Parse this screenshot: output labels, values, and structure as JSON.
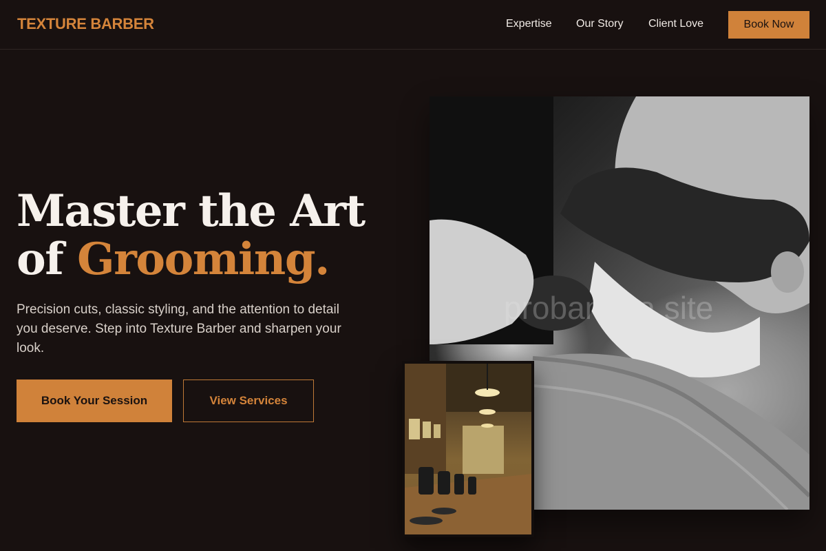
{
  "brand": {
    "name": "TEXTURE BARBER",
    "accent_color": "#d4843a",
    "background_color": "#181110"
  },
  "nav": {
    "links": [
      {
        "label": "Expertise"
      },
      {
        "label": "Our Story"
      },
      {
        "label": "Client Love"
      }
    ],
    "cta_label": "Book Now"
  },
  "hero": {
    "title_line1": "Master the Art",
    "title_line2_prefix": "of",
    "title_line2_accent": "Grooming.",
    "description": "Precision cuts, classic styling, and the attention to detail you deserve. Step into Texture Barber and sharpen your look.",
    "primary_button": "Book Your Session",
    "secondary_button": "View Services"
  },
  "images": {
    "main": {
      "subject": "barber applying shaving cream to bearded man",
      "watermark": "probanana.site"
    },
    "secondary": {
      "subject": "barbershop interior with chairs and pendant lights"
    }
  }
}
